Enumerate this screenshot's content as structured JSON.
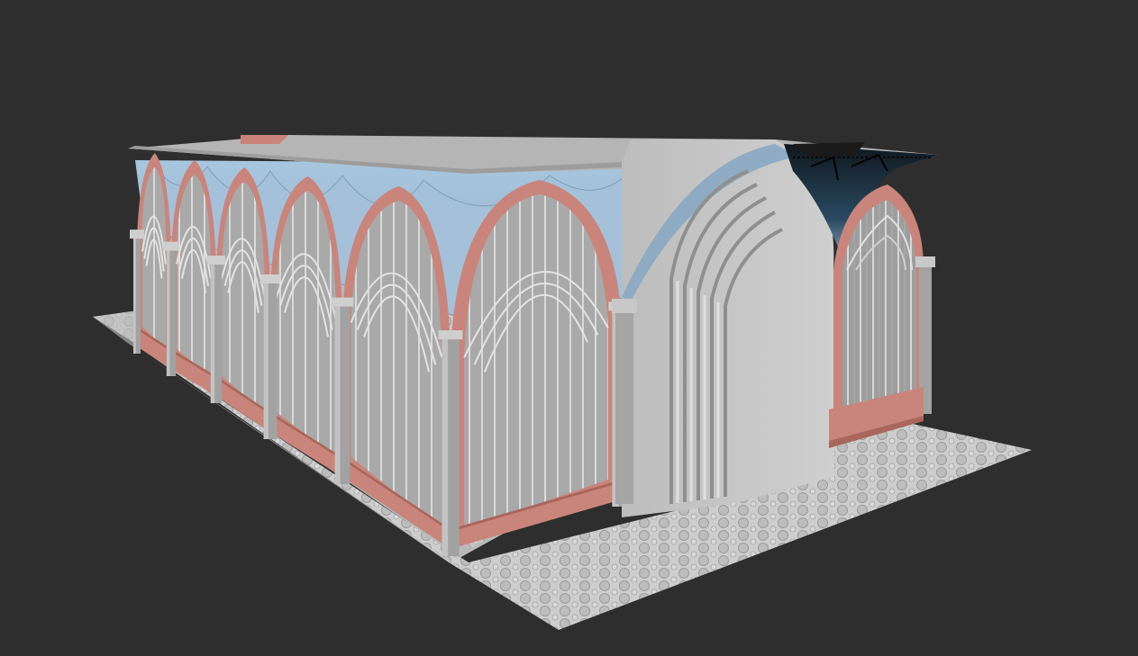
{
  "viewport": {
    "background_color": "#2e2e2e",
    "scene": "3d-viewport",
    "model": {
      "subject": "gothic-cloister-hall",
      "bay_count_long_side": 6,
      "bay_count_short_side": 1,
      "materials": {
        "floor_tile": "#c9c9c9",
        "floor_tile_line": "#9e9e9e",
        "stone_gray": "#c3c3c3",
        "stone_gray_dark": "#a2a2a2",
        "brick_pink": "#c9857b",
        "brick_pink_dark": "#a9665c",
        "vault_blue": "#9dbad3",
        "vault_blue_dark": "#7e9db8",
        "roof_gray": "#b7b7b7",
        "glitch_black": "#1c2a33"
      }
    }
  }
}
